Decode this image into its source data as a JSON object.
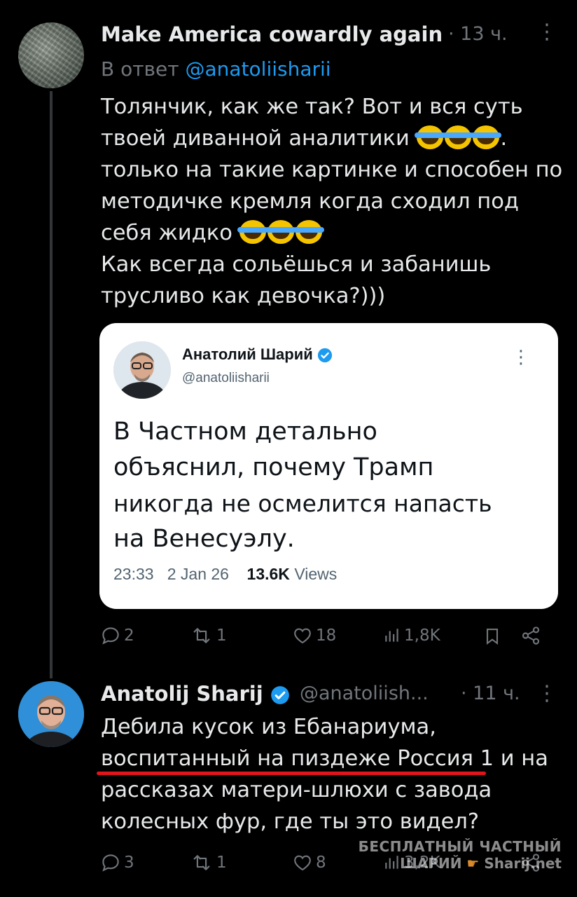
{
  "reply_tweet": {
    "author": "Make America cowardly again",
    "time": "· 13 ч.",
    "reply_to_prefix": "В ответ",
    "reply_to_handle": "@anatoliisharii",
    "text_lines": [
      "Толянчик, как же так? Вот и вся суть",
      "твоей диванной аналитики",
      "только на такие картинке и способен по",
      "методичке кремля когда сходил под",
      "себя жидко",
      "Как всегда сольёшься и забанишь",
      "трусливо как девочка?)))"
    ],
    "line2_tail": ".",
    "emoji": "face-with-tears-of-joy",
    "quoted_image": {
      "author": "Анатолий Шарий",
      "handle": "@anatoliisharii",
      "text_lines": [
        "В Частном детально",
        "объяснил, почему Трамп",
        "никогда не осмелится напасть",
        "на Венесуэлу."
      ],
      "time": "23:33",
      "date": "2 Jan 26",
      "views_count": "13.6K",
      "views_label": "Views"
    },
    "stats": {
      "replies": "2",
      "reposts": "1",
      "likes": "18",
      "views": "1,8K"
    }
  },
  "answer_tweet": {
    "author": "Anatolij Sharij",
    "handle": "@anatoliish...",
    "time": "· 11 ч.",
    "text_lines": [
      "Дебила кусок из Ебанариума,",
      "воспитанный на пиздеже Россия 1",
      "рассказах матери-шлюхи с завода",
      "колесных фур, где ты это видел?"
    ],
    "line2_tail": " и на",
    "stats": {
      "replies": "3",
      "reposts": "1",
      "likes": "8",
      "views": "3,2K"
    }
  },
  "watermark": {
    "line1": "БЕСПЛАТНЫЙ ЧАСТНЫЙ",
    "line2": "ШАРИЙ",
    "line2_site": "Sharij.net"
  },
  "colors": {
    "background": "#000000",
    "muted": "#71767b",
    "link": "#1d9bf0",
    "verified": "#1d9bf0",
    "highlight_underline": "#e0141a"
  }
}
